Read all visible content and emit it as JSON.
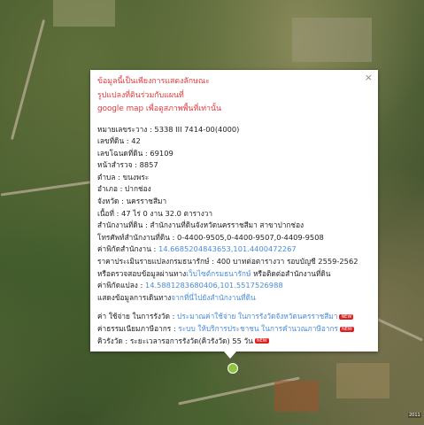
{
  "popup": {
    "disclaimer": [
      "ข้อมูลนี้เป็นเพียงการแสดงลักษณะ",
      "รูปแปลงที่ดินร่วมกับแผนที่",
      "google map เพื่อดูสภาพพื้นที่เท่านั้น"
    ],
    "fields": [
      {
        "label": "หมายเลขระวาง",
        "value": "5338 III 7414-00(4000)"
      },
      {
        "label": "เลขที่ดิน",
        "value": "42"
      },
      {
        "label": "เลขโฉนดที่ดิน",
        "value": "69109"
      },
      {
        "label": "หน้าสำรวจ",
        "value": "8857"
      },
      {
        "label": "ตำบล",
        "value": "ขนงพระ"
      },
      {
        "label": "อำเภอ",
        "value": "ปากช่อง"
      },
      {
        "label": "จังหวัด",
        "value": "นครราชสีมา"
      },
      {
        "label": "เนื้อที่",
        "value": "47 ไร่ 0 งาน 32.0 ตารางวา"
      },
      {
        "label": "สำนักงานที่ดิน",
        "value": "สำนักงานที่ดินจังหวัดนครราชสีมา สาขาปากช่อง"
      },
      {
        "label": "โทรศัพท์สำนักงานที่ดิน",
        "value": "0-4400-9505,0-4400-9507,0-4409-9508"
      }
    ],
    "office_coord_label": "ค่าพิกัดสำนักงาน",
    "office_coord_value": "14.6685204843653,101.4400472267",
    "price_text": "ราคาประเมินรายแปลงกรมธนารักษ์ : 400 บาทต่อตารางวา รอบบัญชี 2559-2562",
    "verify_prefix": "หรือตรวจสอบข้อมูลผ่านทาง",
    "verify_link": "เว็บไซต์กรมธนารักษ์",
    "verify_suffix": "หรือติดต่อสำนักงานที่ดิน",
    "parcel_coord_label": "ค่าพิกัดแปลง",
    "parcel_coord_value": "14.5881283680406,101.5517526988",
    "route_prefix": "แสดงข้อมูลการเดินทาง",
    "route_link": "จากที่นี่ไปยังสำนักงานที่ดิน",
    "fee_label": "ค่า ใช้จ่าย ในการรังวัด",
    "fee_link": "ประมาณค่าใช้จ่าย ในการรังวัดจังหวัดนครราชสีมา",
    "tax_label": "ค่าธรรมเนียมภาษีอากร",
    "tax_link": "ระบบ ให้บริการประชาชน ในการคำนวณภาษีอากร",
    "queue_label": "คิวรังวัด",
    "queue_value": "ระยะเวลารอการรังวัด(คิวรังวัด) 55 วัน",
    "new_badge": "NEW",
    "close": "×"
  },
  "map": {
    "scale_label": "2011"
  },
  "colors": {
    "disclaimer": "#e0393e",
    "link": "#4a8cd8",
    "marker": "#8cc63f",
    "new_badge": "#e02020"
  }
}
